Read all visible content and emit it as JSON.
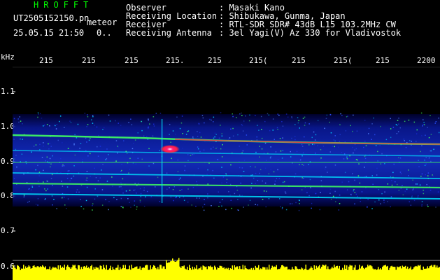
{
  "header": {
    "brand": "HROFFT",
    "filename": "UT2505152150.pn",
    "event_type": "meteor",
    "datetime": "25.05.15 21:50",
    "count": "0.."
  },
  "station_info": {
    "labels": [
      "Observer",
      "Receiving Location",
      "Receiver",
      "Receiving Antenna"
    ],
    "values": [
      ": Masaki Kano",
      ": Shibukawa, Gunma, Japan",
      ": RTL-SDR SDR# 43dB L15 103.2MHz CW",
      ": 3el Yagi(V) Az 330 for Vladivostok"
    ]
  },
  "axes": {
    "y_unit": "kHz",
    "y_ticks": [
      "1.1",
      "1.0",
      "0.9",
      "0.8",
      "0.7",
      "0.6"
    ],
    "x_ticks": [
      "215",
      "215",
      "215",
      "215.",
      "215",
      "215(",
      "215",
      "215(",
      "215",
      "2200"
    ]
  },
  "colors": {
    "background": "#000000",
    "noise_dark": "#00008b",
    "noise_mid": "#1e3cff",
    "trace_cyan": "#00e0ff",
    "trace_green": "#40ff60",
    "trace_red": "#ff2040",
    "meteor_head": "#ff2080",
    "amplitude": "#ffff00"
  }
}
